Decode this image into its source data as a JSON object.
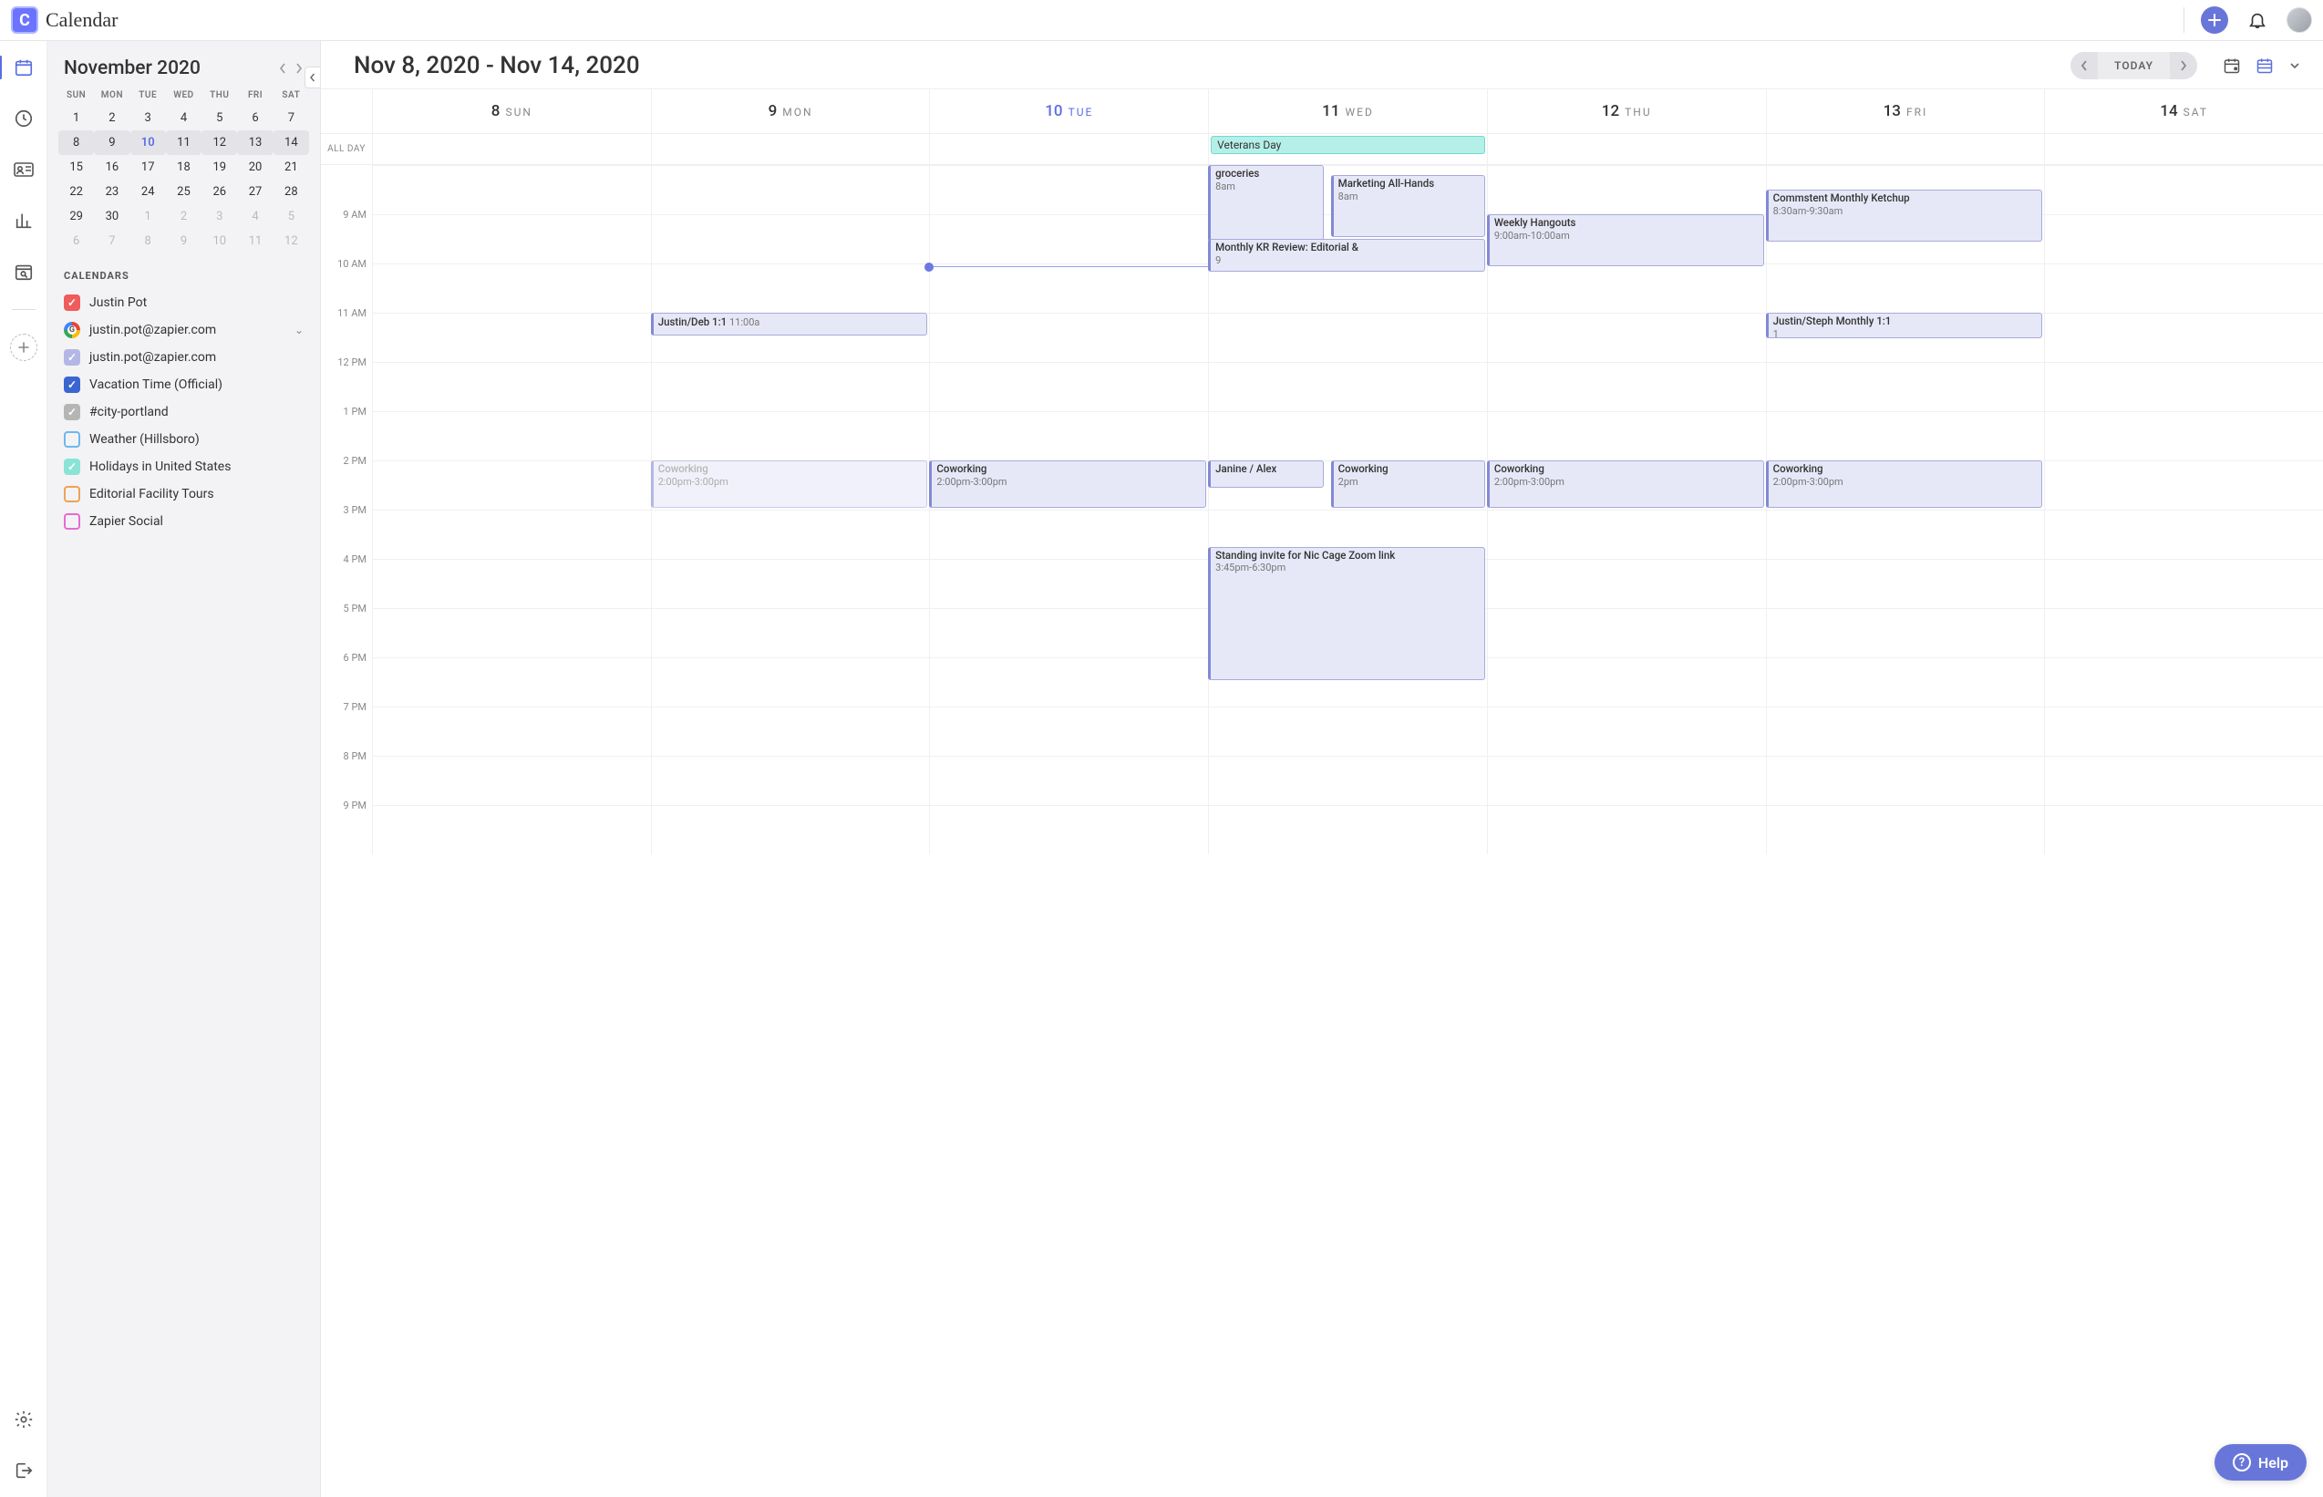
{
  "brand": "Calendar",
  "mini": {
    "title": "November 2020",
    "dow": [
      "SUN",
      "MON",
      "TUE",
      "WED",
      "THU",
      "FRI",
      "SAT"
    ],
    "weeks": [
      [
        {
          "n": "1"
        },
        {
          "n": "2"
        },
        {
          "n": "3"
        },
        {
          "n": "4"
        },
        {
          "n": "5"
        },
        {
          "n": "6"
        },
        {
          "n": "7"
        }
      ],
      [
        {
          "n": "8",
          "hl": true
        },
        {
          "n": "9",
          "hl": true
        },
        {
          "n": "10",
          "hl": true,
          "today": true
        },
        {
          "n": "11",
          "hl": true
        },
        {
          "n": "12",
          "hl": true
        },
        {
          "n": "13",
          "hl": true
        },
        {
          "n": "14",
          "hl": true
        }
      ],
      [
        {
          "n": "15"
        },
        {
          "n": "16"
        },
        {
          "n": "17"
        },
        {
          "n": "18"
        },
        {
          "n": "19"
        },
        {
          "n": "20"
        },
        {
          "n": "21"
        }
      ],
      [
        {
          "n": "22"
        },
        {
          "n": "23"
        },
        {
          "n": "24"
        },
        {
          "n": "25"
        },
        {
          "n": "26"
        },
        {
          "n": "27"
        },
        {
          "n": "28"
        }
      ],
      [
        {
          "n": "29"
        },
        {
          "n": "30"
        },
        {
          "n": "1",
          "dim": true
        },
        {
          "n": "2",
          "dim": true
        },
        {
          "n": "3",
          "dim": true
        },
        {
          "n": "4",
          "dim": true
        },
        {
          "n": "5",
          "dim": true
        }
      ],
      [
        {
          "n": "6",
          "dim": true
        },
        {
          "n": "7",
          "dim": true
        },
        {
          "n": "8",
          "dim": true
        },
        {
          "n": "9",
          "dim": true
        },
        {
          "n": "10",
          "dim": true
        },
        {
          "n": "11",
          "dim": true
        },
        {
          "n": "12",
          "dim": true
        }
      ]
    ]
  },
  "calendars_header": "CALENDARS",
  "calendars": [
    {
      "type": "check",
      "color": "#f05b5b",
      "checked": true,
      "label": "Justin Pot"
    },
    {
      "type": "google",
      "label": "justin.pot@zapier.com",
      "expandable": true
    },
    {
      "type": "check",
      "color": "#b2b7e6",
      "checked": true,
      "label": "justin.pot@zapier.com"
    },
    {
      "type": "check",
      "color": "#3b66d1",
      "checked": true,
      "label": "Vacation Time (Official)"
    },
    {
      "type": "check",
      "color": "#b5b5b5",
      "checked": true,
      "label": "#city-portland"
    },
    {
      "type": "outline",
      "color": "#6db7f0",
      "label": "Weather (Hillsboro)"
    },
    {
      "type": "check",
      "color": "#8ae4d6",
      "checked": true,
      "label": "Holidays in United States"
    },
    {
      "type": "outline",
      "color": "#f0a254",
      "label": "Editorial Facility Tours"
    },
    {
      "type": "outline",
      "color": "#e66bd2",
      "label": "Zapier Social"
    }
  ],
  "header": {
    "date_range": "Nov 8, 2020 - Nov 14, 2020",
    "today_label": "TODAY"
  },
  "days": [
    {
      "n": "8",
      "d": "SUN"
    },
    {
      "n": "9",
      "d": "MON"
    },
    {
      "n": "10",
      "d": "TUE",
      "today": true
    },
    {
      "n": "11",
      "d": "WED"
    },
    {
      "n": "12",
      "d": "THU"
    },
    {
      "n": "13",
      "d": "FRI"
    },
    {
      "n": "14",
      "d": "SAT"
    }
  ],
  "allday_label": "ALL DAY",
  "allday_events": [
    {
      "day": 3,
      "title": "Veterans Day"
    }
  ],
  "time_labels": [
    "",
    "9 AM",
    "10 AM",
    "11 AM",
    "12 PM",
    "1 PM",
    "2 PM",
    "3 PM",
    "4 PM",
    "5 PM",
    "6 PM",
    "7 PM",
    "8 PM",
    "9 PM"
  ],
  "grid_start_hour": 8,
  "now": {
    "day": 2,
    "hour": 10.05
  },
  "events": [
    {
      "day": 3,
      "start": 8,
      "end": 9.6,
      "title": "groceries",
      "time": "8am",
      "left": 0,
      "width": 0.42
    },
    {
      "day": 3,
      "start": 8.2,
      "end": 9.5,
      "title": "Marketing All-Hands",
      "time": "8am",
      "left": 0.44,
      "width": 0.56
    },
    {
      "day": 3,
      "start": 9.5,
      "end": 10.2,
      "title": "Monthly KR Review: Editorial &",
      "time": "9",
      "left": 0,
      "width": 1.0
    },
    {
      "day": 4,
      "start": 9,
      "end": 10.1,
      "title": "Weekly Hangouts",
      "time": "9:00am-10:00am",
      "left": 0,
      "width": 1.0
    },
    {
      "day": 5,
      "start": 8.5,
      "end": 9.6,
      "title": "Commstent Monthly Ketchup",
      "time": "8:30am-9:30am",
      "left": 0,
      "width": 1.0
    },
    {
      "day": 1,
      "start": 11,
      "end": 11.5,
      "title": "Justin/Deb 1:1",
      "time": "11:00a",
      "inline_time": true,
      "left": 0,
      "width": 1.0
    },
    {
      "day": 5,
      "start": 11,
      "end": 11.55,
      "title": "Justin/Steph Monthly 1:1",
      "time": "1",
      "left": 0,
      "width": 1.0
    },
    {
      "day": 1,
      "start": 14,
      "end": 15,
      "title": "Coworking",
      "time": "2:00pm-3:00pm",
      "dim": true,
      "left": 0,
      "width": 1.0
    },
    {
      "day": 2,
      "start": 14,
      "end": 15,
      "title": "Coworking",
      "time": "2:00pm-3:00pm",
      "left": 0,
      "width": 1.0
    },
    {
      "day": 3,
      "start": 14,
      "end": 14.6,
      "title": "Janine / Alex",
      "time": "",
      "left": 0,
      "width": 0.42
    },
    {
      "day": 3,
      "start": 14,
      "end": 15,
      "title": "Coworking",
      "time": "2pm",
      "left": 0.44,
      "width": 0.56
    },
    {
      "day": 4,
      "start": 14,
      "end": 15,
      "title": "Coworking",
      "time": "2:00pm-3:00pm",
      "left": 0,
      "width": 1.0
    },
    {
      "day": 5,
      "start": 14,
      "end": 15,
      "title": "Coworking",
      "time": "2:00pm-3:00pm",
      "left": 0,
      "width": 1.0
    },
    {
      "day": 3,
      "start": 15.75,
      "end": 18.5,
      "title": "Standing invite for Nic Cage Zoom link",
      "time": "3:45pm-6:30pm",
      "left": 0,
      "width": 1.0
    }
  ],
  "help_label": "Help"
}
